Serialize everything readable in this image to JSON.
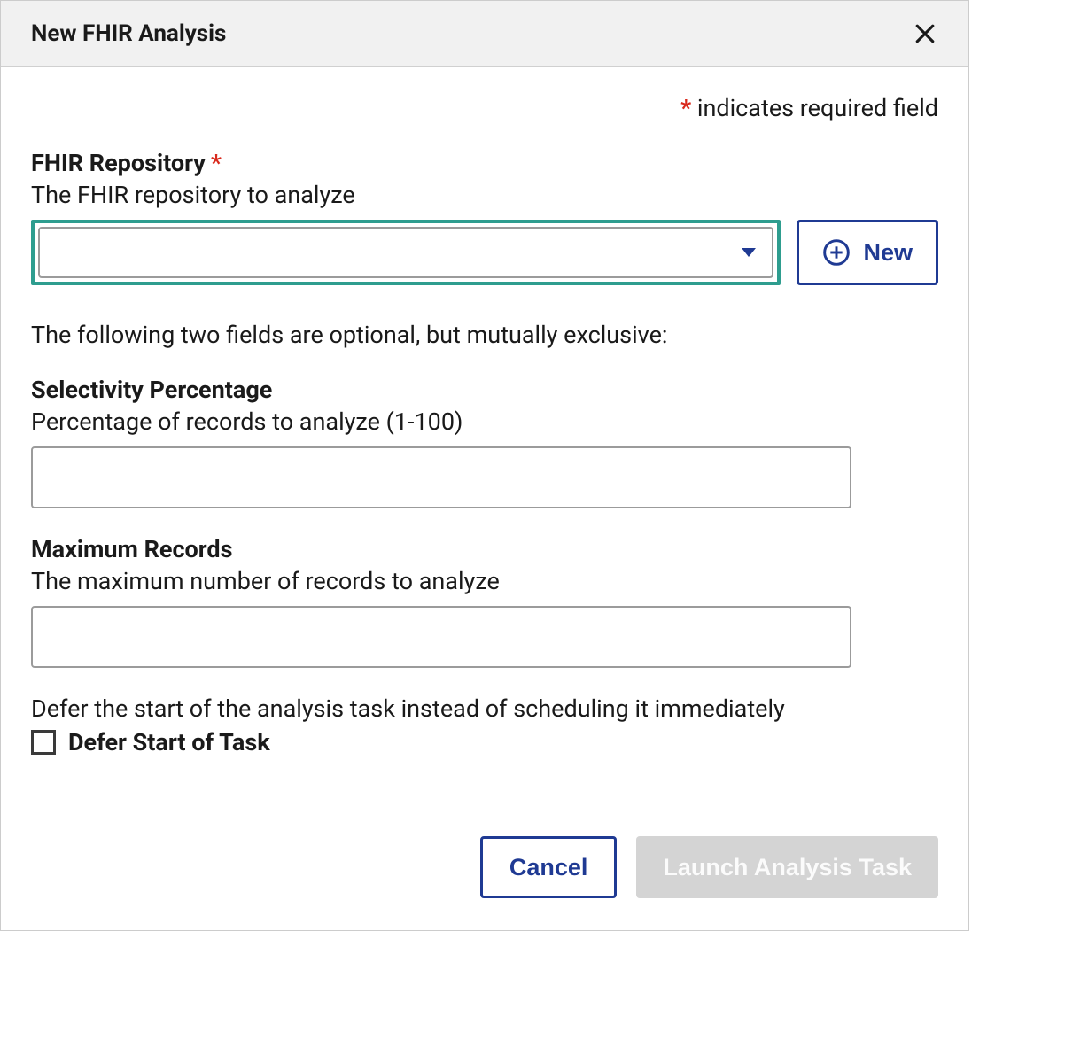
{
  "dialog": {
    "title": "New FHIR Analysis",
    "required_note_prefix": "*",
    "required_note_text": " indicates required field"
  },
  "fields": {
    "repository": {
      "label": "FHIR Repository",
      "required_marker": "*",
      "description": "The FHIR repository to analyze",
      "value": "",
      "new_button_label": "New"
    },
    "optional_note": "The following two fields are optional, but mutually exclusive:",
    "selectivity": {
      "label": "Selectivity Percentage",
      "description": "Percentage of records to analyze (1-100)",
      "value": ""
    },
    "max_records": {
      "label": "Maximum Records",
      "description": "The maximum number of records to analyze",
      "value": ""
    },
    "defer": {
      "description": "Defer the start of the analysis task instead of scheduling it immediately",
      "checkbox_label": "Defer Start of Task",
      "checked": false
    }
  },
  "footer": {
    "cancel_label": "Cancel",
    "launch_label": "Launch Analysis Task"
  }
}
